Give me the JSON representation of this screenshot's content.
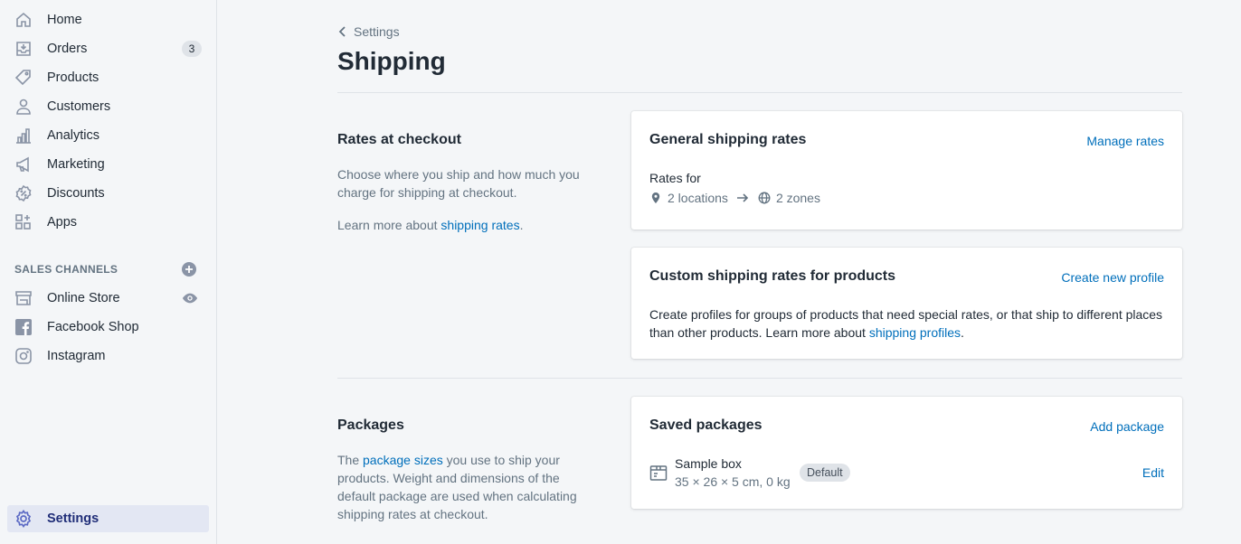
{
  "sidebar": {
    "items": [
      {
        "label": "Home",
        "icon": "home-icon"
      },
      {
        "label": "Orders",
        "icon": "orders-icon",
        "badge": "3"
      },
      {
        "label": "Products",
        "icon": "tag-icon"
      },
      {
        "label": "Customers",
        "icon": "person-icon"
      },
      {
        "label": "Analytics",
        "icon": "bar-chart-icon"
      },
      {
        "label": "Marketing",
        "icon": "megaphone-icon"
      },
      {
        "label": "Discounts",
        "icon": "discount-icon"
      },
      {
        "label": "Apps",
        "icon": "apps-icon"
      }
    ],
    "sales_channels_title": "SALES CHANNELS",
    "channels": [
      {
        "label": "Online Store",
        "icon": "store-icon"
      },
      {
        "label": "Facebook Shop",
        "icon": "facebook-icon"
      },
      {
        "label": "Instagram",
        "icon": "instagram-icon"
      }
    ],
    "settings_label": "Settings"
  },
  "header": {
    "breadcrumb": "Settings",
    "title": "Shipping"
  },
  "rates_section": {
    "title": "Rates at checkout",
    "description": "Choose where you ship and how much you charge for shipping at checkout.",
    "learn_prefix": "Learn more about ",
    "learn_link": "shipping rates",
    "learn_suffix": "."
  },
  "general_rates_card": {
    "title": "General shipping rates",
    "action": "Manage rates",
    "rates_for": "Rates for",
    "locations": "2 locations",
    "zones": "2 zones"
  },
  "custom_rates_card": {
    "title": "Custom shipping rates for products",
    "action": "Create new profile",
    "text": "Create profiles for groups of products that need special rates, or that ship to different places than other products. Learn more about ",
    "link": "shipping profiles",
    "suffix": "."
  },
  "packages_section": {
    "title": "Packages",
    "prefix": "The ",
    "link": "package sizes",
    "description": " you use to ship your products. Weight and dimensions of the default package are used when calculating shipping rates at checkout."
  },
  "saved_packages_card": {
    "title": "Saved packages",
    "action": "Add package",
    "package_name": "Sample box",
    "package_dims": "35 × 26 × 5 cm, 0 kg",
    "badge": "Default",
    "edit": "Edit"
  },
  "colors": {
    "accent": "#006fbb",
    "nav_active_bg": "#e3e7f3",
    "nav_active_text": "#202e78",
    "icon": "#919eab"
  }
}
